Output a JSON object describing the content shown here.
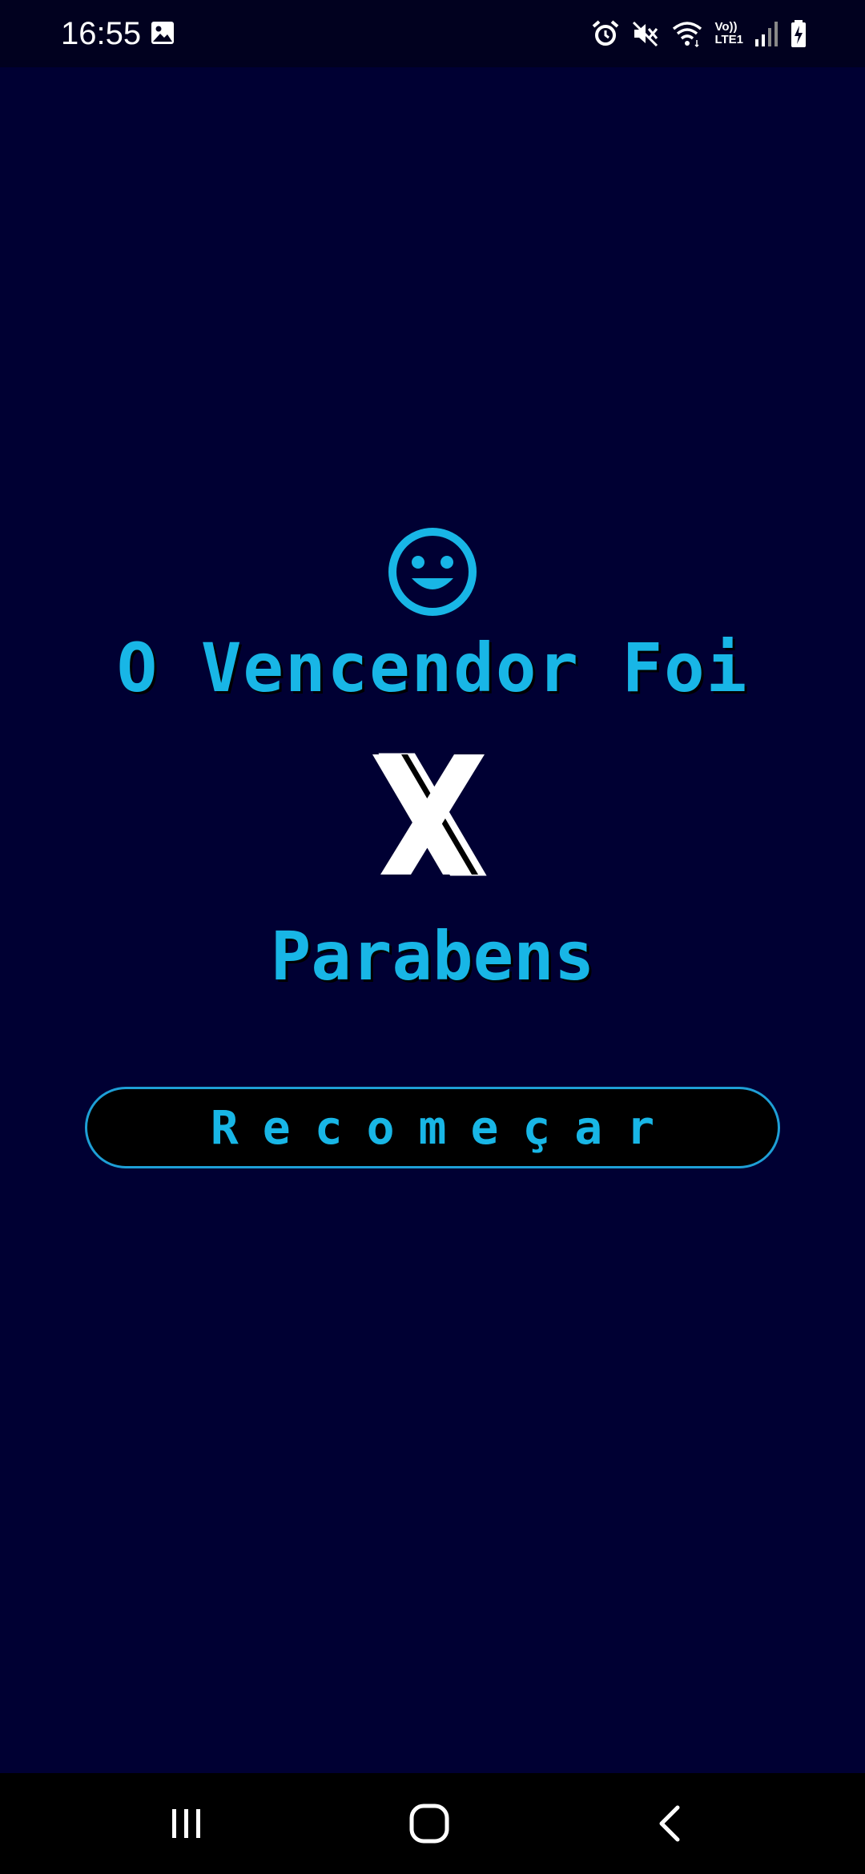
{
  "status_bar": {
    "time": "16:55",
    "left_icons": [
      "image-icon"
    ],
    "right_icons": [
      "alarm-icon",
      "mute-icon",
      "wifi-icon",
      "volte-icon",
      "signal-icon",
      "battery-charging-icon"
    ],
    "volte_line1": "Vo))",
    "volte_line2": "LTE1"
  },
  "game_over": {
    "emoji_icon": "smiley-icon",
    "heading": "O Vencendor Foi",
    "winner": "X",
    "congrats": "Parabens",
    "restart_label": "Recomeçar"
  },
  "navigation_bar": {
    "buttons": [
      "recent-apps-icon",
      "home-icon",
      "back-icon"
    ]
  },
  "colors": {
    "background": "#000033",
    "accent": "#18b6e6",
    "button_border": "#1e9fd6",
    "button_fill": "#000000",
    "winner_symbol": "#ffffff"
  }
}
